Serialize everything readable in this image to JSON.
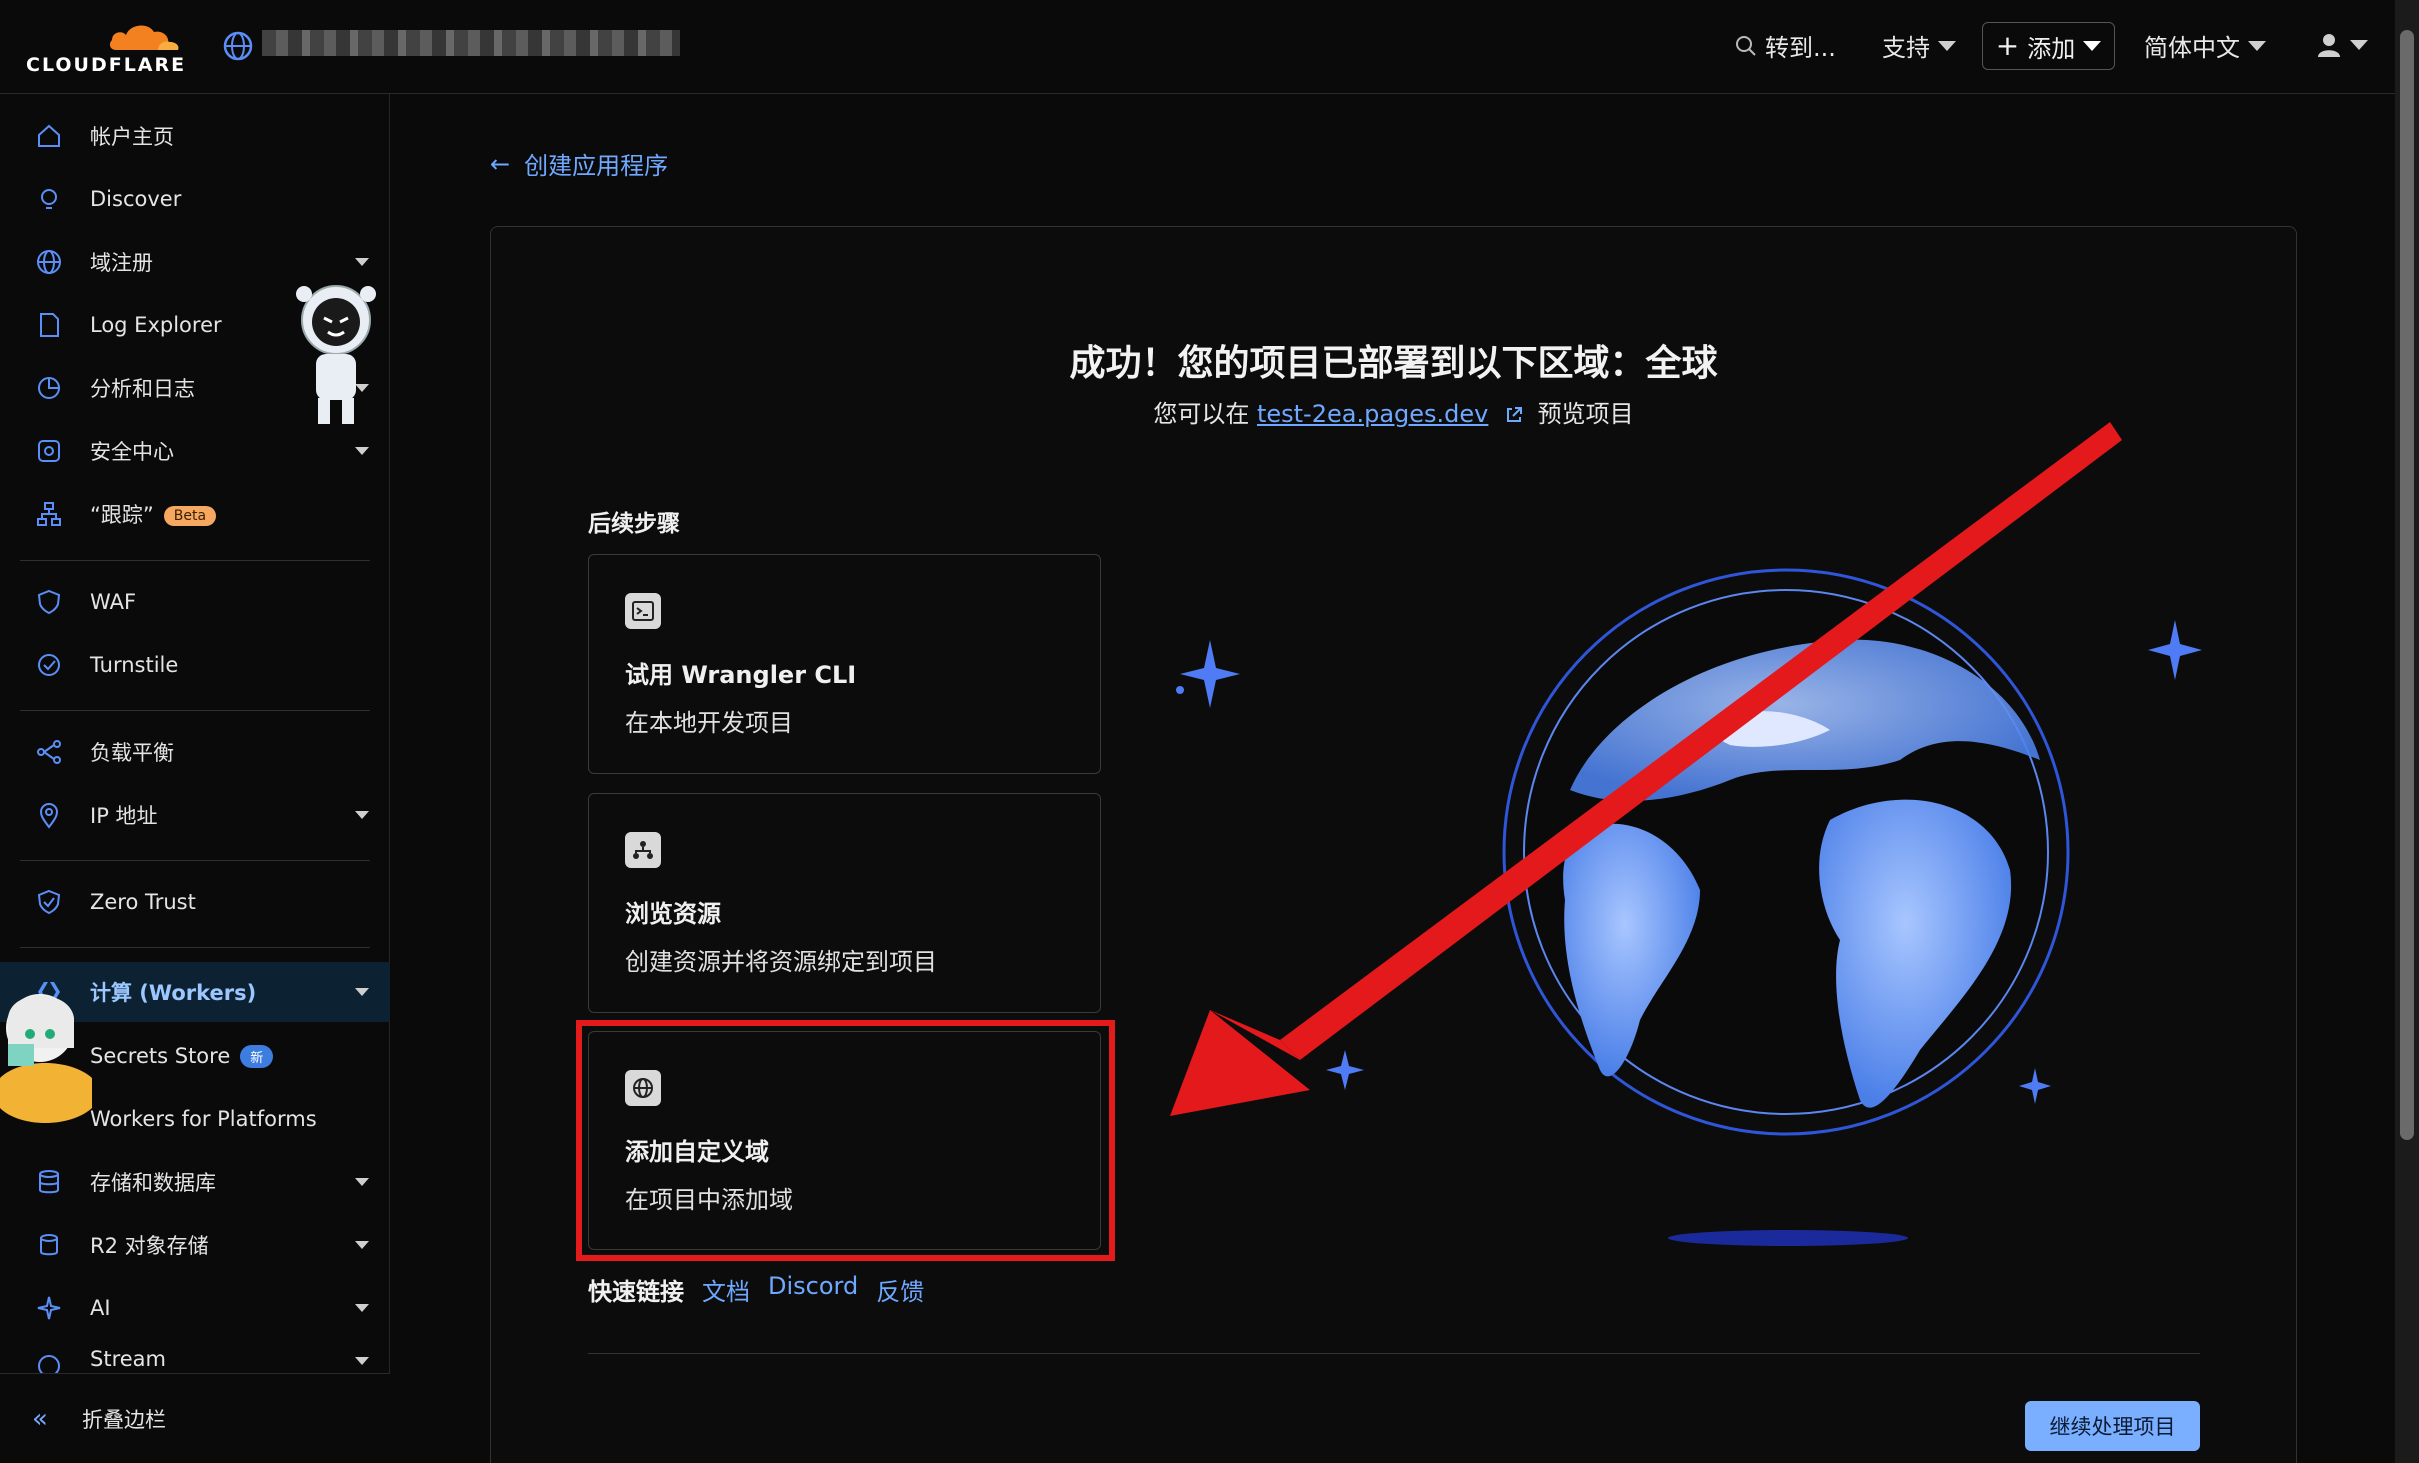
{
  "topbar": {
    "brand": "CLOUDFLARE",
    "goto_label": "转到...",
    "support_label": "支持",
    "add_label": "添加",
    "language_label": "简体中文"
  },
  "sidebar": {
    "items": [
      {
        "label": "帐户主页",
        "icon": "home-icon"
      },
      {
        "label": "Discover",
        "icon": "lightbulb-icon"
      },
      {
        "label": "域注册",
        "icon": "globe-icon"
      },
      {
        "label": "Log Explorer",
        "icon": "document-icon"
      },
      {
        "label": "分析和日志",
        "icon": "chart-pie-icon"
      },
      {
        "label": "安全中心",
        "icon": "security-center-icon"
      },
      {
        "label": "“跟踪”",
        "icon": "trace-icon",
        "badge": "Beta"
      },
      {
        "label": "WAF",
        "icon": "shield-icon"
      },
      {
        "label": "Turnstile",
        "icon": "turnstile-icon"
      },
      {
        "label": "负载平衡",
        "icon": "load-balance-icon"
      },
      {
        "label": "IP 地址",
        "icon": "location-pin-icon"
      },
      {
        "label": "Zero Trust",
        "icon": "zero-trust-icon"
      },
      {
        "label": "计算 (Workers)",
        "icon": "compute-icon"
      },
      {
        "label": "Secrets Store",
        "badge": "新"
      },
      {
        "label": "Workers for Platforms"
      },
      {
        "label": "存储和数据库",
        "icon": "database-icon"
      },
      {
        "label": "R2 对象存储",
        "icon": "storage-icon"
      },
      {
        "label": "AI",
        "icon": "sparkle-icon"
      },
      {
        "label": "Stream",
        "icon": "stream-icon"
      }
    ],
    "collapse_label": "折叠边栏"
  },
  "main": {
    "back_label": "创建应用程序",
    "success_title": "成功！您的项目已部署到以下区域：全球",
    "success_sub_prefix": "您可以在",
    "success_link": "test-2ea.pages.dev",
    "success_sub_suffix": "预览项目",
    "steps_title": "后续步骤",
    "cards": [
      {
        "title": "试用 Wrangler CLI",
        "desc": "在本地开发项目",
        "icon": "terminal-icon"
      },
      {
        "title": "浏览资源",
        "desc": "创建资源并将资源绑定到项目",
        "icon": "bindings-icon"
      },
      {
        "title": "添加自定义域",
        "desc": "在项目中添加域",
        "icon": "globe-icon"
      }
    ],
    "quick_links_title": "快速链接",
    "quick_links": [
      "文档",
      "Discord",
      "反馈"
    ],
    "continue_label": "继续处理项目"
  },
  "colors": {
    "accent": "#6fa8ff",
    "annotation": "#e31b1b",
    "background": "#0a0a0a"
  }
}
